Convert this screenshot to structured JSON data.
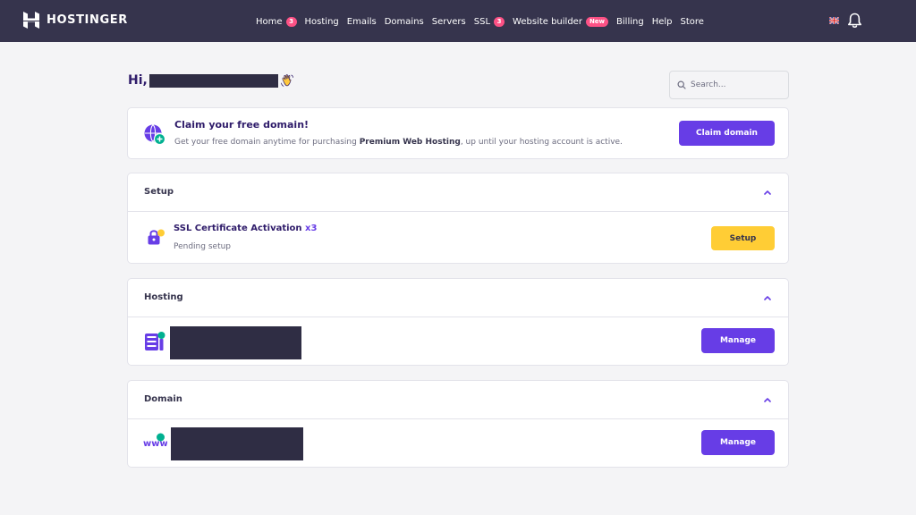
{
  "brand": {
    "name": "HOSTINGER"
  },
  "nav": {
    "items": [
      {
        "label": "Home",
        "badge": "3"
      },
      {
        "label": "Hosting"
      },
      {
        "label": "Emails"
      },
      {
        "label": "Domains"
      },
      {
        "label": "Servers"
      },
      {
        "label": "SSL",
        "badge": "3"
      },
      {
        "label": "Website builder",
        "badge": "New"
      },
      {
        "label": "Billing"
      },
      {
        "label": "Help"
      },
      {
        "label": "Store"
      }
    ]
  },
  "icons": {
    "language": "uk-flag-icon",
    "notifications": "bell-icon",
    "search": "search-icon"
  },
  "greeting": {
    "prefix": "Hi,"
  },
  "search": {
    "placeholder": "Search..."
  },
  "claim": {
    "title": "Claim your free domain!",
    "text_before": "Get your free domain anytime for purchasing ",
    "text_bold": "Premium Web Hosting",
    "text_after": ", up until your hosting account is active.",
    "button": "Claim domain"
  },
  "setup": {
    "title": "Setup",
    "item_title": "SSL Certificate Activation",
    "item_count": "x3",
    "item_status": "Pending setup",
    "button": "Setup"
  },
  "hosting": {
    "title": "Hosting",
    "button": "Manage"
  },
  "domain": {
    "title": "Domain",
    "button": "Manage"
  },
  "colors": {
    "topbar": "#36344d",
    "primary": "#673de6",
    "warning": "#ffcd35",
    "badge": "#fc5185",
    "teal": "#00b090"
  }
}
